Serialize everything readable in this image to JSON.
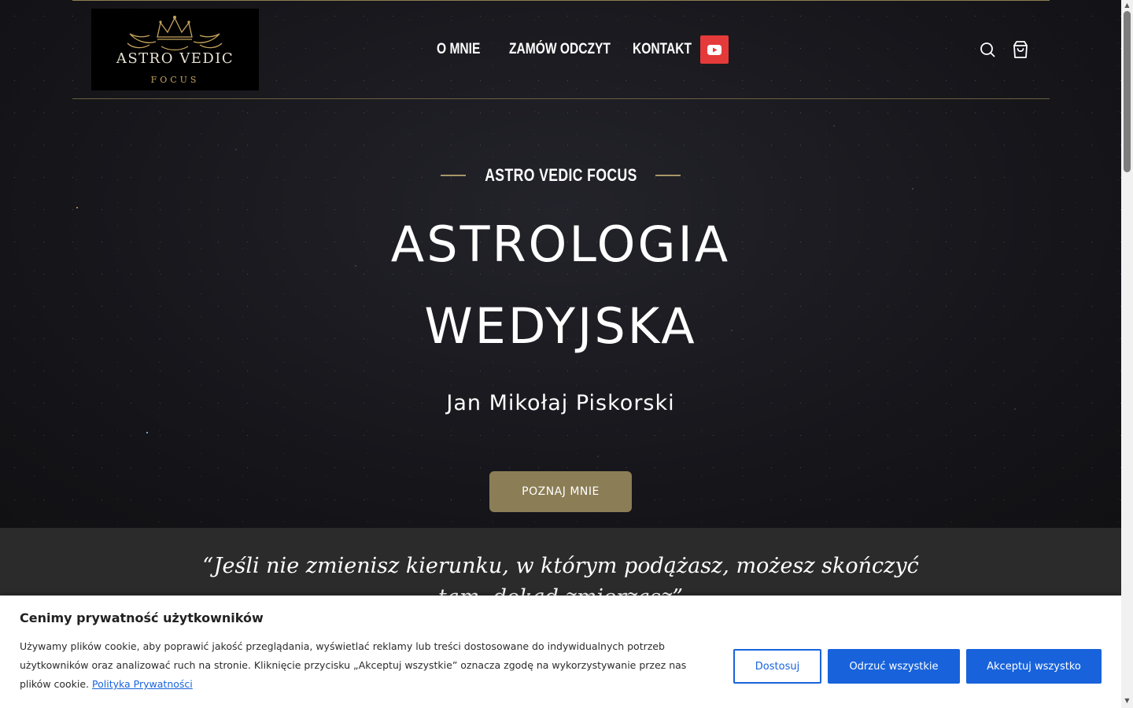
{
  "logo": {
    "title": "ASTRO VEDIC",
    "subtitle": "FOCUS",
    "icon": "crown-icon",
    "gold": "#c6a45c"
  },
  "nav": {
    "items": [
      {
        "label": "O MNIE"
      },
      {
        "label": "ZAMÓW ODCZYT"
      },
      {
        "label": "KONTAKT"
      }
    ],
    "youtube_icon": "youtube-icon",
    "youtube_color": "#e53a3a"
  },
  "header_icons": {
    "search": "search-icon",
    "cart": "shopping-bag-icon"
  },
  "hero": {
    "eyebrow": "ASTRO VEDIC FOCUS",
    "title_line1": "ASTROLOGIA",
    "title_line2": "WEDYJSKA",
    "name": "Jan Mikołaj Piskorski",
    "cta_label": "POZNAJ MNIE",
    "accent": "#8b7d55"
  },
  "quote": {
    "text": "“Jeśli nie zmienisz kierunku, w którym podążasz, możesz skończyć tam, dokąd zmierzasz”"
  },
  "cookie_banner": {
    "title": "Cenimy prywatność użytkowników",
    "text": "Używamy plików cookie, aby poprawić jakość przeglądania, wyświetlać reklamy lub treści dostosowane do indywidualnych potrzeb użytkowników oraz analizować ruch na stronie. Kliknięcie przycisku „Akceptuj wszystkie” oznacza zgodę na wykorzystywanie przez nas plików cookie.",
    "policy_link": "Polityka Prywatności",
    "customize_label": "Dostosuj",
    "reject_label": "Odrzuć wszystkie",
    "accept_label": "Akceptuj wszystko",
    "button_color": "#1863dc"
  }
}
